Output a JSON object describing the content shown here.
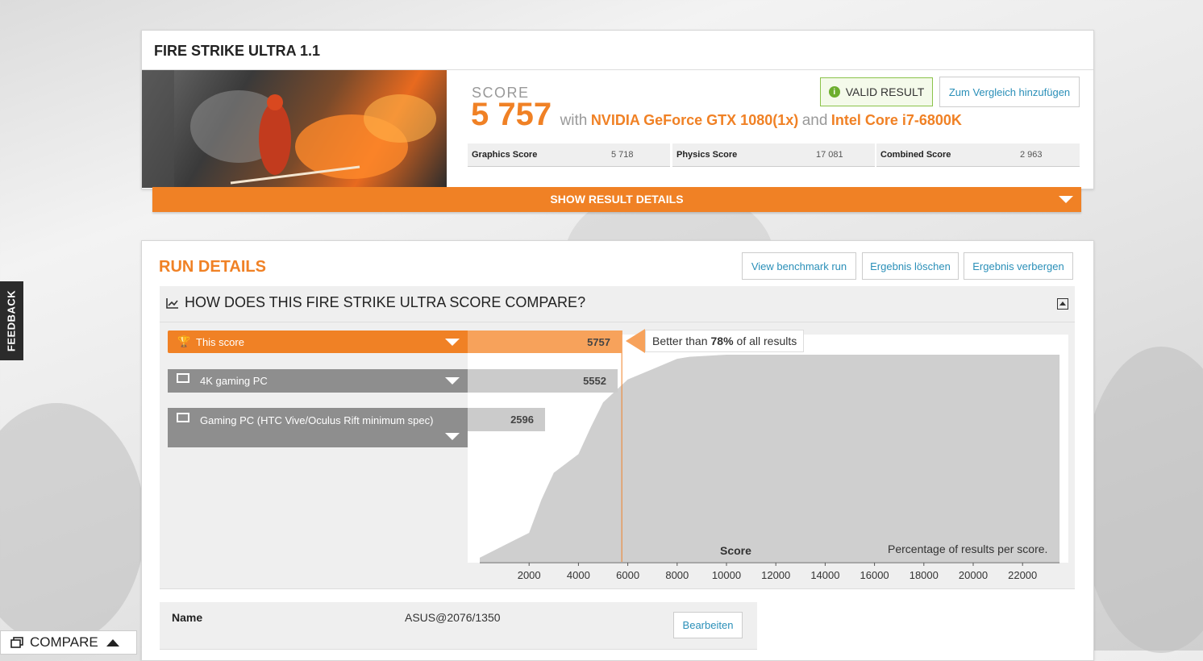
{
  "benchmark": {
    "title": "FIRE STRIKE ULTRA 1.1",
    "score_label": "SCORE",
    "score": "5 757",
    "with_text": "with",
    "gpu": "NVIDIA GeForce GTX 1080(1x)",
    "and_text": "and",
    "cpu": "Intel Core i7-6800K",
    "valid_label": "VALID RESULT",
    "compare_add_label": "Zum Vergleich hinzufügen",
    "subscores": [
      {
        "label": "Graphics Score",
        "value": "5 718"
      },
      {
        "label": "Physics Score",
        "value": "17 081"
      },
      {
        "label": "Combined Score",
        "value": "2 963"
      }
    ],
    "show_details_label": "SHOW RESULT DETAILS"
  },
  "run_details": {
    "title": "RUN DETAILS",
    "buttons": [
      "View benchmark run",
      "Ergebnis löschen",
      "Ergebnis verbergen"
    ],
    "compare_heading": "HOW DOES THIS FIRE STRIKE ULTRA SCORE COMPARE?",
    "rows": [
      {
        "label": "This score",
        "value": "5757"
      },
      {
        "label": "4K gaming PC",
        "value": "5552"
      },
      {
        "label": "Gaming PC (HTC Vive/Oculus Rift minimum spec)",
        "value": "2596"
      }
    ],
    "better_than_prefix": "Better than",
    "better_than_pct": "78%",
    "better_than_suffix": "of all results",
    "score_axis_label": "Score",
    "distribution_note": "Percentage of results per score."
  },
  "details_table": {
    "name_label": "Name",
    "name_value": "ASUS@2076/1350",
    "edit_label": "Bearbeiten"
  },
  "side": {
    "feedback_label": "FEEDBACK",
    "compare_label": "COMPARE"
  },
  "chart_data": {
    "type": "area",
    "x_ticks": [
      "2000",
      "4000",
      "6000",
      "8000",
      "10000",
      "12000",
      "14000",
      "16000",
      "18000",
      "20000",
      "22000"
    ],
    "xlim": [
      0,
      23500
    ],
    "ylim": [
      0,
      100
    ],
    "xlabel": "Score",
    "marker_x": 5757,
    "points": [
      [
        0,
        2
      ],
      [
        1000,
        8
      ],
      [
        2000,
        14
      ],
      [
        2500,
        30
      ],
      [
        3000,
        43
      ],
      [
        4000,
        52
      ],
      [
        4500,
        65
      ],
      [
        5000,
        77
      ],
      [
        6000,
        88
      ],
      [
        7000,
        93
      ],
      [
        8000,
        98
      ],
      [
        8500,
        99
      ],
      [
        10000,
        100
      ],
      [
        12000,
        100
      ],
      [
        14000,
        100
      ],
      [
        16000,
        100
      ],
      [
        18000,
        100
      ],
      [
        20000,
        100
      ],
      [
        22000,
        100
      ],
      [
        23500,
        100
      ]
    ],
    "colors": {
      "accent": "#f08125",
      "area": "#cfcfcf",
      "bar_gray": "#8e8e8e"
    }
  }
}
